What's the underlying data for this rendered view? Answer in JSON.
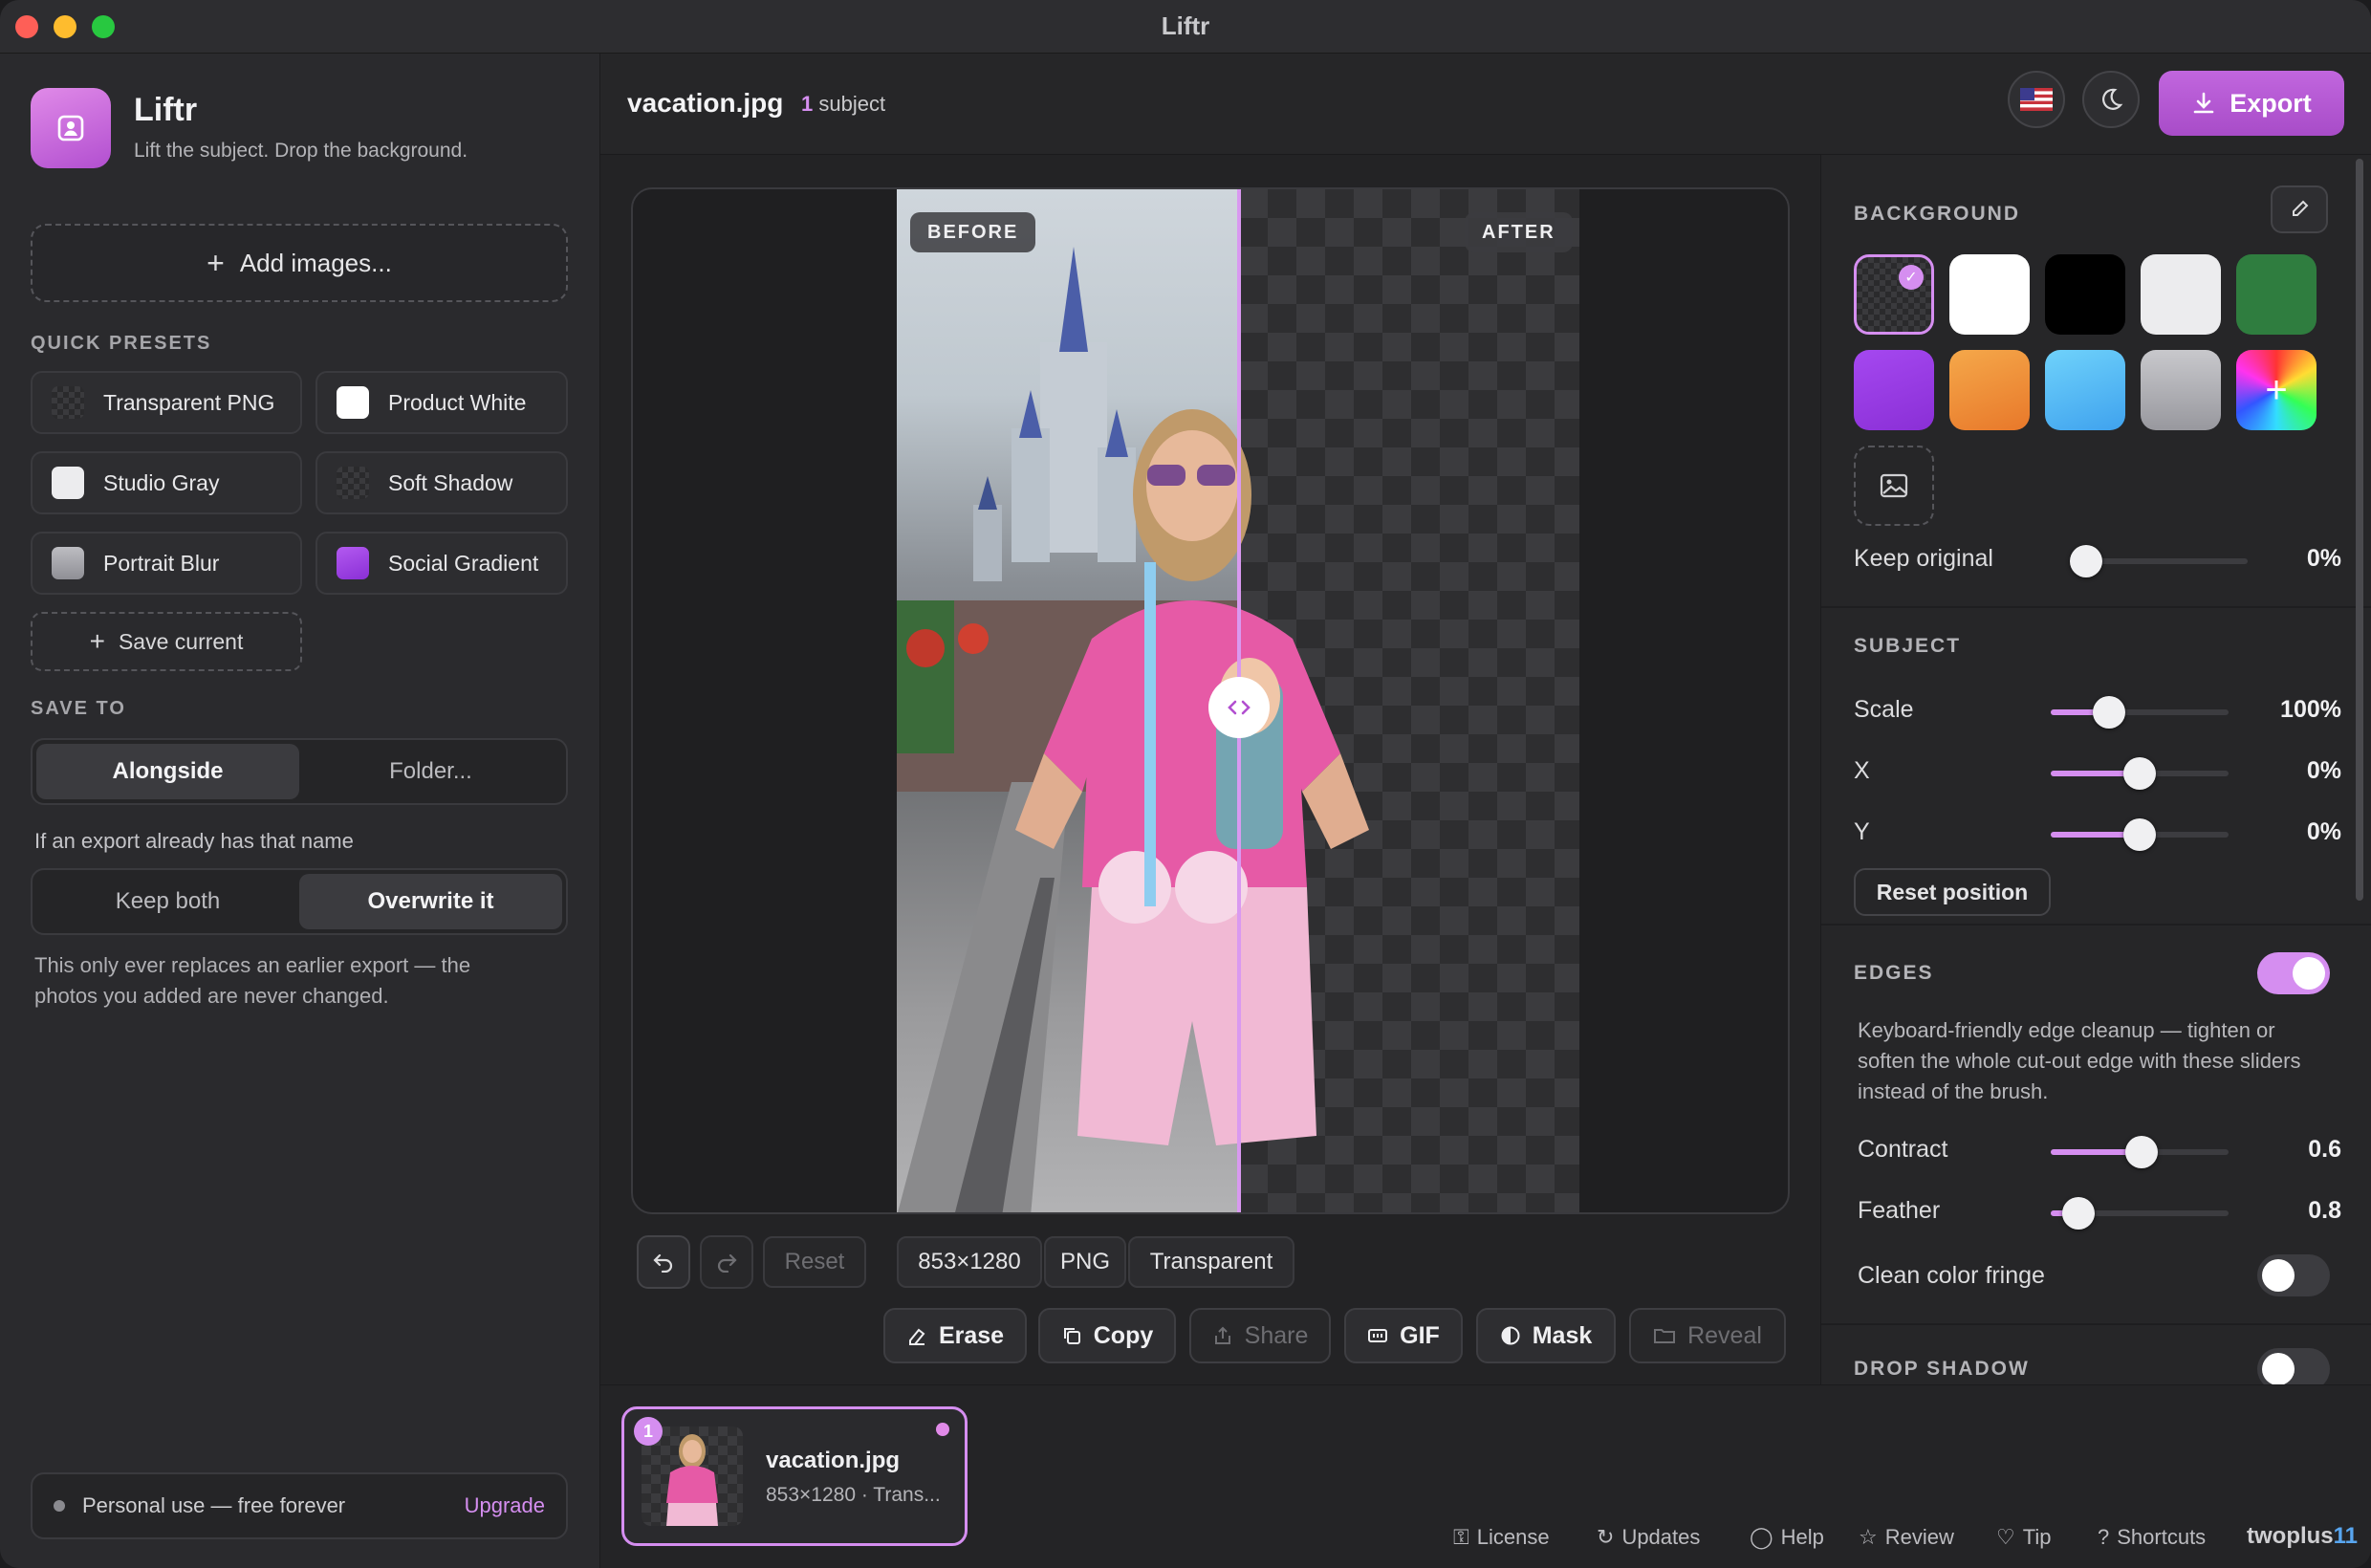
{
  "window": {
    "title": "Liftr"
  },
  "sidebar": {
    "app_name": "Liftr",
    "tagline": "Lift the subject. Drop the background.",
    "add_images": "Add images...",
    "quick_presets_label": "QUICK PRESETS",
    "presets": [
      {
        "label": "Transparent PNG",
        "swatch": "checker"
      },
      {
        "label": "Product White",
        "swatch": "#ffffff"
      },
      {
        "label": "Studio Gray",
        "swatch": "#ececee"
      },
      {
        "label": "Soft Shadow",
        "swatch": "checker"
      },
      {
        "label": "Portrait Blur",
        "swatch": "#a9a9ae"
      },
      {
        "label": "Social Gradient",
        "swatch": "#9b3fe0"
      }
    ],
    "save_current": "Save current",
    "save_to_label": "SAVE TO",
    "save_to_options": [
      "Alongside",
      "Folder..."
    ],
    "save_to_selected": "Alongside",
    "conflict_label": "If an export already has that name",
    "conflict_options": [
      "Keep both",
      "Overwrite it"
    ],
    "conflict_selected": "Overwrite it",
    "conflict_hint_1": "This only ever replaces an earlier export — the",
    "conflict_hint_2": "photos you added are never changed.",
    "license_text": "Personal use — free forever",
    "upgrade": "Upgrade"
  },
  "header": {
    "file_name": "vacation.jpg",
    "subject_count": "1",
    "subject_label": "subject",
    "flag_icon": "us-flag-icon",
    "theme_icon": "moon-icon",
    "export": "Export"
  },
  "canvas": {
    "before_label": "BEFORE",
    "after_label": "AFTER",
    "reset": "Reset",
    "dimensions": "853×1280",
    "format": "PNG",
    "background": "Transparent",
    "actions": [
      {
        "label": "Erase",
        "enabled": true
      },
      {
        "label": "Copy",
        "enabled": true
      },
      {
        "label": "Share",
        "enabled": false
      },
      {
        "label": "GIF",
        "enabled": true
      },
      {
        "label": "Mask",
        "enabled": true
      },
      {
        "label": "Reveal",
        "enabled": false
      }
    ]
  },
  "background_panel": {
    "label": "BACKGROUND",
    "swatches": [
      "checker",
      "#ffffff",
      "#000000",
      "#ececee",
      "#2f7d3f",
      "#9b3fe0",
      "#f0903a",
      "#5bbdf5",
      "#b4b4b8",
      "rainbow"
    ],
    "keep_original_label": "Keep original",
    "keep_original_value": "0%",
    "keep_original_level": 0
  },
  "subject_panel": {
    "label": "SUBJECT",
    "scale_label": "Scale",
    "scale_value": "100%",
    "x_label": "X",
    "x_value": "0%",
    "y_label": "Y",
    "y_value": "0%",
    "reset_position": "Reset position"
  },
  "edges_panel": {
    "label": "EDGES",
    "enabled": true,
    "description": "Keyboard-friendly edge cleanup — tighten or soften the whole cut-out edge with these sliders instead of the brush.",
    "contract_label": "Contract",
    "contract_value": "0.6",
    "feather_label": "Feather",
    "feather_value": "0.8",
    "clean_fringe_label": "Clean color fringe",
    "clean_fringe_enabled": false
  },
  "drop_shadow_panel": {
    "label": "DROP SHADOW",
    "enabled": false
  },
  "filmstrip": {
    "items": [
      {
        "index": "1",
        "name": "vacation.jpg",
        "meta": "853×1280 · Trans..."
      }
    ]
  },
  "footer": {
    "links": [
      "License",
      "Updates",
      "Help",
      "Review",
      "Tip",
      "Shortcuts"
    ],
    "brand_a": "twoplus",
    "brand_b": "11"
  },
  "colors": {
    "accent": "#d58ef0",
    "export": "#b456d4"
  }
}
